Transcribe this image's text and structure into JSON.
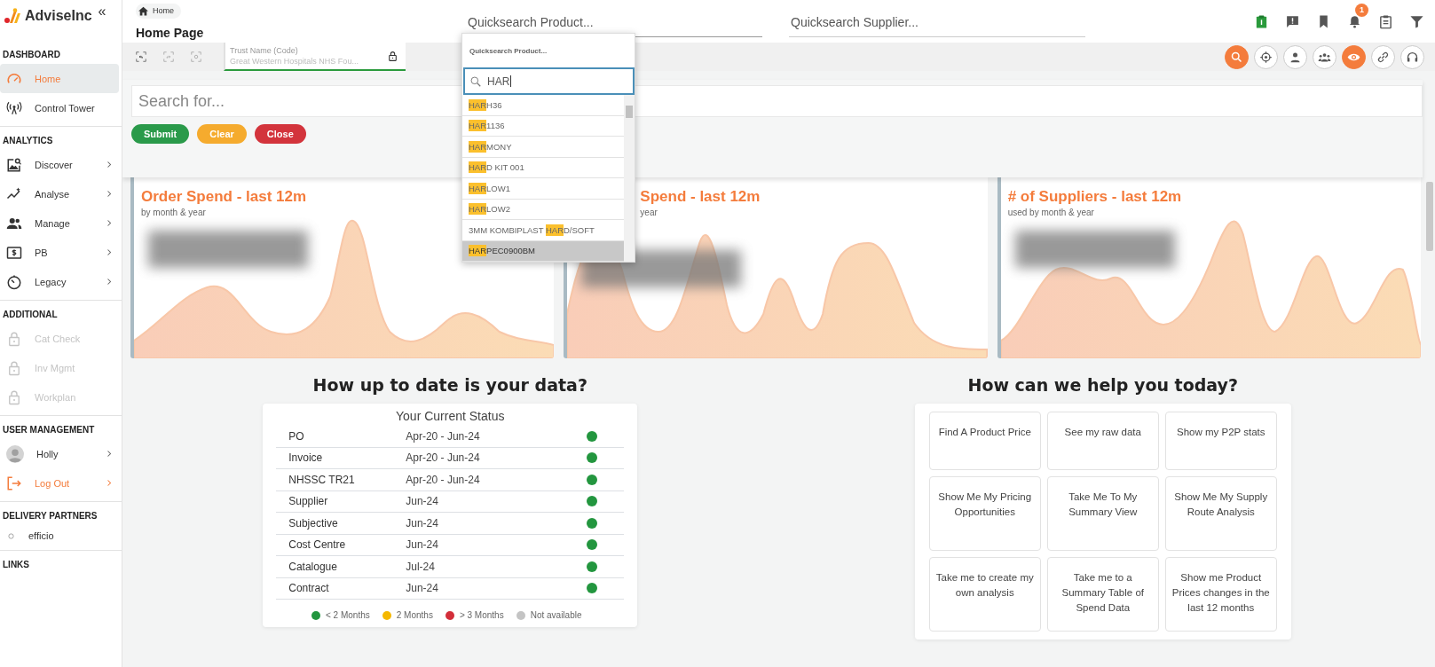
{
  "sidebar": {
    "brand": "AdviseInc",
    "collapse_glyph": "«",
    "sections": [
      {
        "title": "DASHBOARD",
        "items": [
          {
            "label": "Home",
            "kind": "nav",
            "selected": true,
            "disabled": false,
            "submenu": false
          },
          {
            "label": "Control Tower",
            "kind": "nav",
            "selected": false,
            "disabled": false,
            "submenu": false
          }
        ]
      },
      {
        "title": "ANALYTICS",
        "items": [
          {
            "label": "Discover",
            "kind": "nav",
            "selected": false,
            "disabled": false,
            "submenu": true
          },
          {
            "label": "Analyse",
            "kind": "nav",
            "selected": false,
            "disabled": false,
            "submenu": true
          },
          {
            "label": "Manage",
            "kind": "nav",
            "selected": false,
            "disabled": false,
            "submenu": true
          },
          {
            "label": "PB",
            "kind": "nav",
            "selected": false,
            "disabled": false,
            "submenu": true
          },
          {
            "label": "Legacy",
            "kind": "nav",
            "selected": false,
            "disabled": false,
            "submenu": true
          }
        ]
      },
      {
        "title": "ADDITIONAL",
        "items": [
          {
            "label": "Cat Check",
            "kind": "nav",
            "selected": false,
            "disabled": true,
            "submenu": false
          },
          {
            "label": "Inv Mgmt",
            "kind": "nav",
            "selected": false,
            "disabled": true,
            "submenu": false
          },
          {
            "label": "Workplan",
            "kind": "nav",
            "selected": false,
            "disabled": true,
            "submenu": false
          }
        ]
      },
      {
        "title": "USER MANAGEMENT",
        "items": [
          {
            "label": "Holly",
            "kind": "user",
            "selected": false,
            "disabled": false,
            "submenu": true
          },
          {
            "label": "Log Out",
            "kind": "logout",
            "selected": false,
            "disabled": false,
            "submenu": true
          }
        ]
      },
      {
        "title": "DELIVERY PARTNERS",
        "items": [
          {
            "label": "efficio",
            "kind": "partner",
            "selected": false,
            "disabled": false,
            "submenu": false
          }
        ]
      },
      {
        "title": "LINKS"
      }
    ]
  },
  "topbar": {
    "breadcrumb": "Home",
    "page_title": "Home Page",
    "product_search": {
      "placeholder": "Quicksearch Product..."
    },
    "supplier_search": {
      "placeholder": "Quicksearch Supplier..."
    },
    "notification_count": "1"
  },
  "toolbar": {
    "trust_field": {
      "label": "Trust Name (Code)",
      "value": "Great Western Hospitals NHS Fou..."
    },
    "round_buttons": [
      {
        "on": true
      },
      {
        "on": false
      },
      {
        "on": false
      },
      {
        "on": false
      },
      {
        "on": true
      },
      {
        "on": false
      },
      {
        "on": false
      }
    ]
  },
  "search_panel": {
    "placeholder": "Search for...",
    "buttons": [
      {
        "label": "Submit",
        "kind": "submit"
      },
      {
        "label": "Clear",
        "kind": "clear"
      },
      {
        "label": "Close",
        "kind": "close"
      }
    ]
  },
  "product_dropdown": {
    "header": "Quicksearch Product...",
    "query": "HAR",
    "results": [
      {
        "match": "HAR",
        "after": "H36",
        "selected": false
      },
      {
        "match": "HAR",
        "after": "1136",
        "selected": false
      },
      {
        "match": "HAR",
        "after": "MONY",
        "selected": false
      },
      {
        "match": "HAR",
        "after": "D KIT 001",
        "selected": false
      },
      {
        "match": "HAR",
        "after": "LOW1",
        "selected": false
      },
      {
        "match": "HAR",
        "after": "LOW2",
        "selected": false
      },
      {
        "before": "3MM KOMBIPLAST ",
        "match": "HAR",
        "after": "D/SOFT",
        "selected": false
      },
      {
        "match": "HAR",
        "after": "PEC0900BM",
        "selected": true
      }
    ]
  },
  "cards": [
    {
      "title": "Order Spend - last 12m",
      "subtitle": "by month & year"
    },
    {
      "title": "Spend - last 12m",
      "subtitle": "year"
    },
    {
      "title": "# of Suppliers - last 12m",
      "subtitle": "used by month & year"
    }
  ],
  "data_status": {
    "heading": "How up to date is your data?",
    "title": "Your Current Status",
    "rows": [
      {
        "name": "PO",
        "range": "Apr-20 - Jun-24",
        "color": "#23963f"
      },
      {
        "name": "Invoice",
        "range": "Apr-20 - Jun-24",
        "color": "#23963f"
      },
      {
        "name": "NHSSC TR21",
        "range": "Apr-20 - Jun-24",
        "color": "#23963f"
      },
      {
        "name": "Supplier",
        "range": "Jun-24",
        "color": "#23963f"
      },
      {
        "name": "Subjective",
        "range": "Jun-24",
        "color": "#23963f"
      },
      {
        "name": "Cost Centre",
        "range": "Jun-24",
        "color": "#23963f"
      },
      {
        "name": "Catalogue",
        "range": "Jul-24",
        "color": "#23963f"
      },
      {
        "name": "Contract",
        "range": "Jun-24",
        "color": "#23963f"
      }
    ],
    "legend": [
      {
        "label": "< 2 Months",
        "color": "#23963f"
      },
      {
        "label": "2 Months",
        "color": "#f5b800"
      },
      {
        "label": "> 3 Months",
        "color": "#d32f3a"
      },
      {
        "label": "Not available",
        "color": "#c4c4c4"
      }
    ]
  },
  "help": {
    "heading": "How can we help you today?",
    "tiles": [
      "Find A Product Price",
      "See my raw data",
      "Show my P2P stats",
      "Show Me My Pricing Opportunities",
      "Take Me To My Summary View",
      "Show Me My Supply Route Analysis",
      "Take me to create my own analysis",
      "Take me to a Summary Table of Spend Data",
      "Show me Product Prices changes in the last 12 months"
    ]
  }
}
